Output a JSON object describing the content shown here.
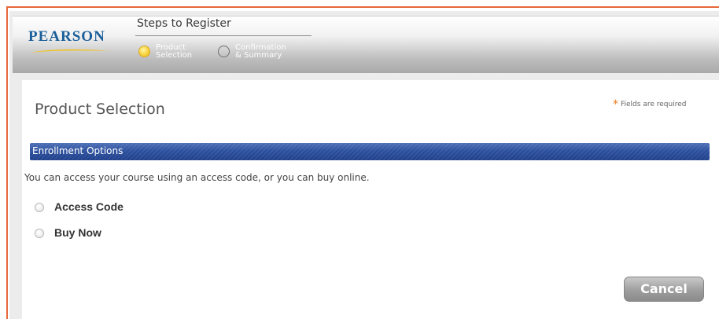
{
  "brand": {
    "logo_text": "PEARSON"
  },
  "steps": {
    "title": "Steps to Register",
    "items": [
      {
        "line1": "Product",
        "line2": "Selection",
        "state": "active"
      },
      {
        "line1": "Confirmation",
        "line2": "& Summary",
        "state": "inactive"
      }
    ]
  },
  "page": {
    "title": "Product Selection",
    "required_star": "*",
    "required_note": "Fields are required"
  },
  "enrollment": {
    "section_title": "Enrollment Options",
    "intro": "You can access your course using an access code, or you can buy online.",
    "options": [
      {
        "label": "Access Code",
        "selected": false
      },
      {
        "label": "Buy Now",
        "selected": false
      }
    ]
  },
  "actions": {
    "cancel_label": "Cancel"
  },
  "colors": {
    "frame_border": "#e8683a",
    "logo_blue": "#1b5f9a",
    "section_bar": "#2b4f9e",
    "active_step": "#f8d23c",
    "required_star": "#f07a1c"
  }
}
